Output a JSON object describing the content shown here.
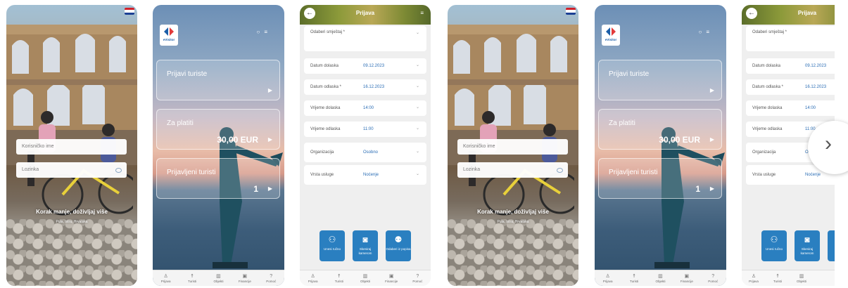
{
  "login": {
    "username_placeholder": "Korisničko ime",
    "password_placeholder": "Lozinka",
    "slogan": "Korak manje, doživljaj više",
    "slogan_sub": "Pula, Istra, Hrvatska"
  },
  "dashboard": {
    "logo_text": "eVisitor",
    "card_register": "Prijavi turiste",
    "card_pay_label": "Za platiti",
    "card_pay_value": "30,00 EUR",
    "card_registered_label": "Prijavljeni turisti",
    "card_registered_value": "1"
  },
  "form": {
    "title": "Prijava",
    "rows": [
      {
        "label": "Odaberi smještaj *",
        "value": ""
      },
      {
        "label": "Datum dolaska",
        "value": "09.12.2023"
      },
      {
        "label": "Datum odlaska *",
        "value": "16.12.2023"
      },
      {
        "label": "Vrijeme dolaska",
        "value": "14:00"
      },
      {
        "label": "Vrijeme odlaska",
        "value": "11:00"
      },
      {
        "label": "Organizacija",
        "value": "Osobno"
      },
      {
        "label": "Vrsta usluge",
        "value": "Noćenje"
      }
    ],
    "buttons": [
      {
        "label": "Unesi ručno",
        "icon": "user-add-icon"
      },
      {
        "label": "Skeniraj kamerom",
        "icon": "camera-icon"
      },
      {
        "label": "Odaberi iz popisa",
        "icon": "users-icon"
      }
    ]
  },
  "nav": [
    {
      "label": "Prijava",
      "icon": "user-icon"
    },
    {
      "label": "Turisti",
      "icon": "person-walking-icon"
    },
    {
      "label": "Objekti",
      "icon": "building-icon"
    },
    {
      "label": "Financije",
      "icon": "wallet-icon"
    },
    {
      "label": "Pomoć",
      "icon": "help-icon"
    }
  ],
  "colors": {
    "accent": "#2a7fc0",
    "value_text": "#2a6db5",
    "nav_bg": "#f4f4f4"
  }
}
